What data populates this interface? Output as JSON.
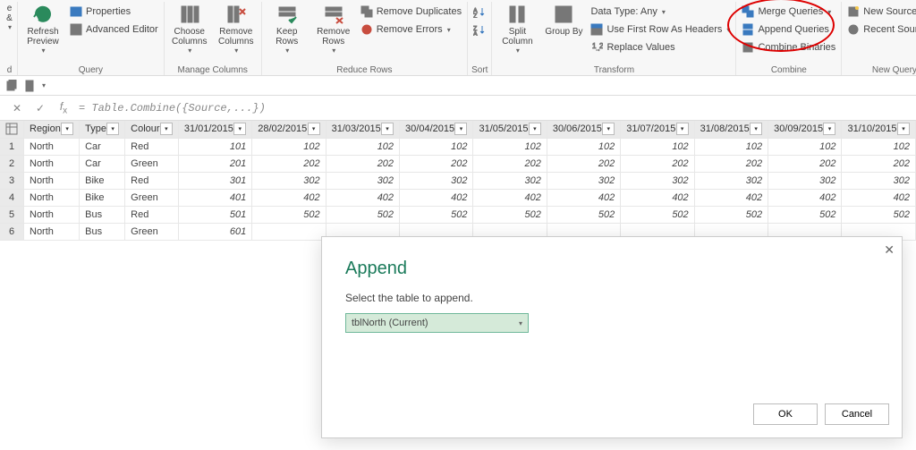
{
  "ribbon": {
    "close_group": {
      "close": "e &",
      "d": "d"
    },
    "query": {
      "refresh": "Refresh\nPreview",
      "properties": "Properties",
      "adv_editor": "Advanced Editor",
      "label": "Query"
    },
    "manage_cols": {
      "choose": "Choose\nColumns",
      "remove": "Remove\nColumns",
      "label": "Manage Columns"
    },
    "reduce_rows": {
      "keep": "Keep\nRows",
      "remove": "Remove\nRows",
      "remove_dup": "Remove Duplicates",
      "remove_err": "Remove Errors",
      "label": "Reduce Rows"
    },
    "sort": {
      "label": "Sort"
    },
    "transform": {
      "split": "Split\nColumn",
      "groupby": "Group\nBy",
      "dtype": "Data Type: Any",
      "first_row": "Use First Row As Headers",
      "replace": "Replace Values",
      "label": "Transform"
    },
    "combine": {
      "merge": "Merge Queries",
      "append": "Append Queries",
      "binaries": "Combine Binaries",
      "label": "Combine"
    },
    "newquery": {
      "newsource": "New Source",
      "recent": "Recent Sources",
      "label": "New Query"
    }
  },
  "formula_bar": {
    "formula": "= Table.Combine({Source,...})"
  },
  "columns": [
    "Region",
    "Type",
    "Colour",
    "31/01/2015",
    "28/02/2015",
    "31/03/2015",
    "30/04/2015",
    "31/05/2015",
    "30/06/2015",
    "31/07/2015",
    "31/08/2015",
    "30/09/2015",
    "31/10/2015"
  ],
  "rows": [
    {
      "n": 1,
      "Region": "North",
      "Type": "Car",
      "Colour": "Red",
      "v": [
        101,
        102,
        102,
        102,
        102,
        102,
        102,
        102,
        102,
        102
      ]
    },
    {
      "n": 2,
      "Region": "North",
      "Type": "Car",
      "Colour": "Green",
      "v": [
        201,
        202,
        202,
        202,
        202,
        202,
        202,
        202,
        202,
        202
      ]
    },
    {
      "n": 3,
      "Region": "North",
      "Type": "Bike",
      "Colour": "Red",
      "v": [
        301,
        302,
        302,
        302,
        302,
        302,
        302,
        302,
        302,
        302
      ]
    },
    {
      "n": 4,
      "Region": "North",
      "Type": "Bike",
      "Colour": "Green",
      "v": [
        401,
        402,
        402,
        402,
        402,
        402,
        402,
        402,
        402,
        402
      ]
    },
    {
      "n": 5,
      "Region": "North",
      "Type": "Bus",
      "Colour": "Red",
      "v": [
        501,
        502,
        502,
        502,
        502,
        502,
        502,
        502,
        502,
        502
      ]
    },
    {
      "n": 6,
      "Region": "North",
      "Type": "Bus",
      "Colour": "Green",
      "v": [
        601,
        null,
        null,
        null,
        null,
        null,
        null,
        null,
        null,
        null
      ]
    }
  ],
  "dialog": {
    "title": "Append",
    "prompt": "Select the table to append.",
    "selected": "tblNorth (Current)",
    "ok": "OK",
    "cancel": "Cancel"
  }
}
